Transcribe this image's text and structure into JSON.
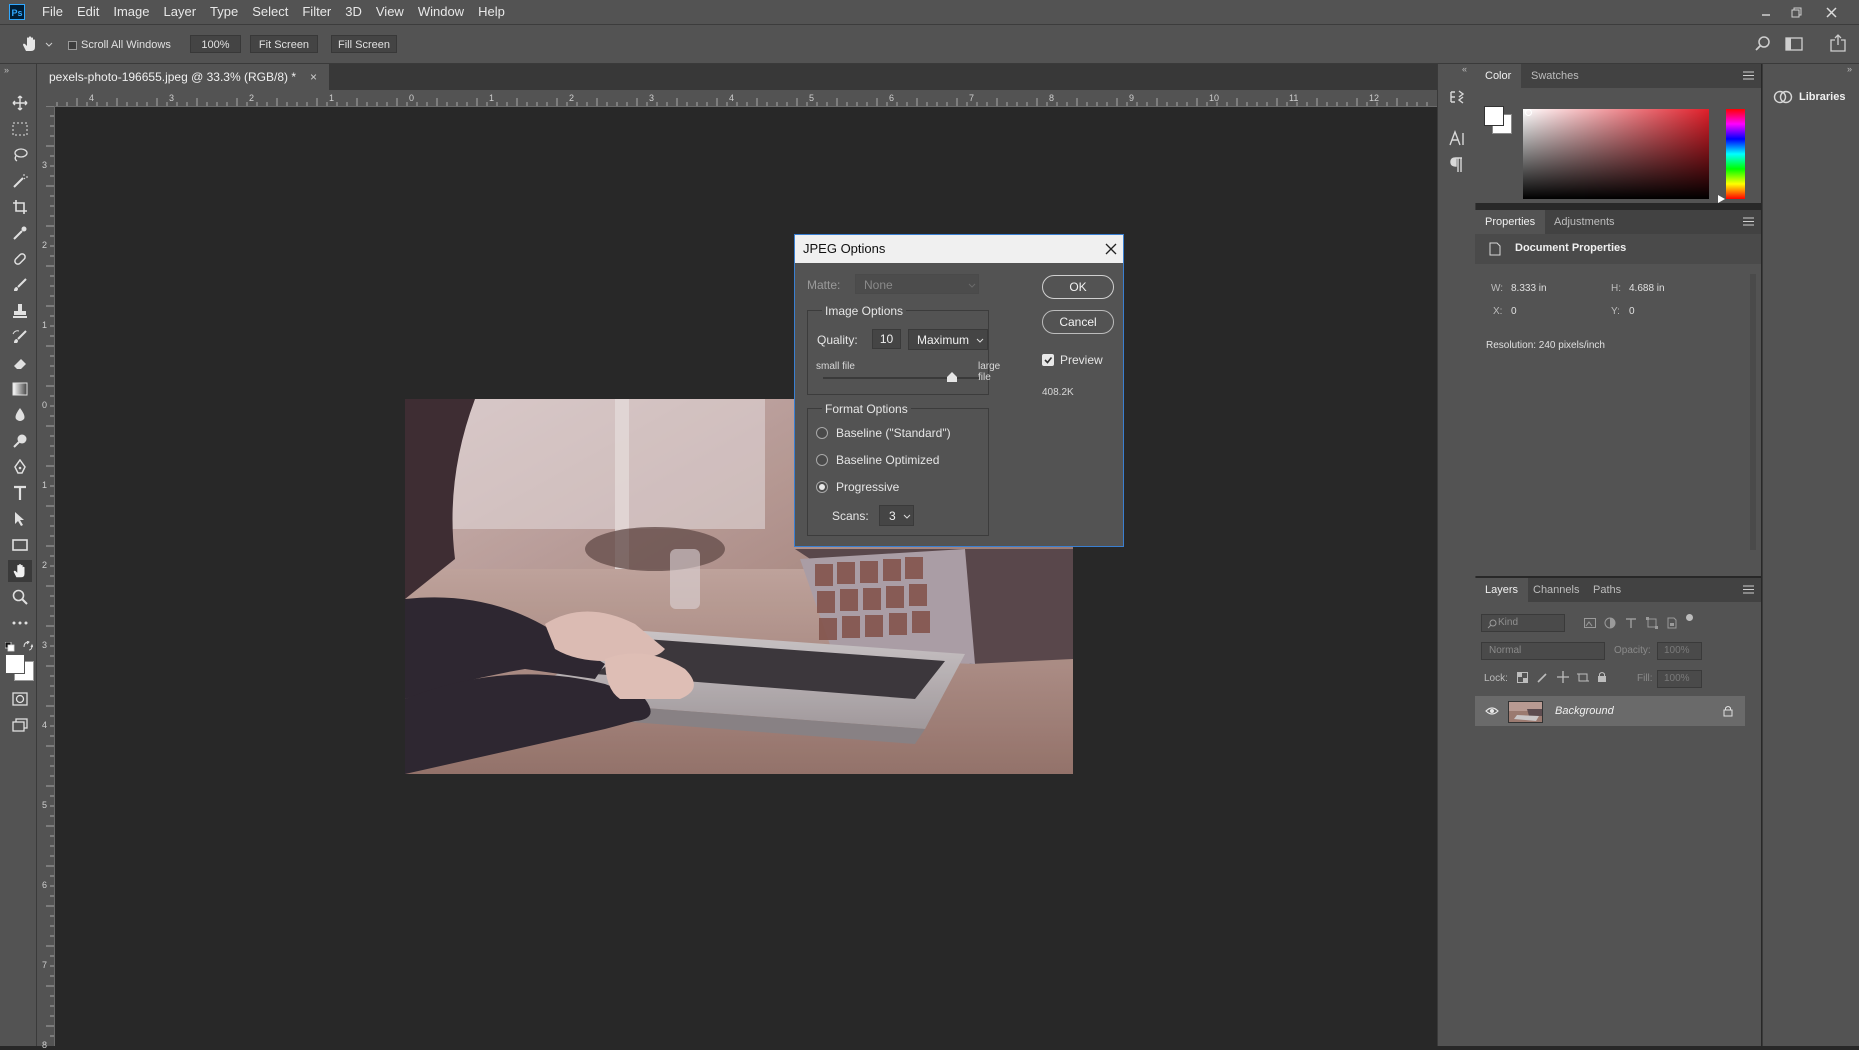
{
  "menubar": {
    "items": [
      "File",
      "Edit",
      "Image",
      "Layer",
      "Type",
      "Select",
      "Filter",
      "3D",
      "View",
      "Window",
      "Help"
    ]
  },
  "options": {
    "scroll_all_windows": "Scroll All Windows",
    "zoom": "100%",
    "fit_screen": "Fit Screen",
    "fill_screen": "Fill Screen"
  },
  "document": {
    "tab_title": "pexels-photo-196655.jpeg @ 33.3% (RGB/8) *",
    "close": "×"
  },
  "ruler": {
    "h": [
      "4",
      "3",
      "2",
      "1",
      "0",
      "1",
      "2",
      "3",
      "4",
      "5",
      "6",
      "7",
      "8",
      "9",
      "10",
      "11",
      "12"
    ],
    "v": [
      "3",
      "2",
      "1",
      "0",
      "1",
      "2",
      "3",
      "4",
      "5",
      "6",
      "7",
      "8"
    ]
  },
  "dialog": {
    "title": "JPEG Options",
    "matte_label": "Matte:",
    "matte_value": "None",
    "image_options": "Image Options",
    "quality_label": "Quality:",
    "quality_value": "10",
    "quality_preset": "Maximum",
    "small_file": "small file",
    "large_file": "large file",
    "quality_level": 0.83,
    "ok": "OK",
    "cancel": "Cancel",
    "preview": "Preview",
    "preview_checked": true,
    "file_size": "408.2K",
    "format_options": "Format Options",
    "formats": [
      "Baseline (\"Standard\")",
      "Baseline Optimized",
      "Progressive"
    ],
    "selected_format": "Progressive",
    "scans_label": "Scans:",
    "scans_value": "3"
  },
  "color_panel": {
    "tabs": [
      "Color",
      "Swatches"
    ],
    "hue_color": "#e01f2a"
  },
  "properties_panel": {
    "tabs": [
      "Properties",
      "Adjustments"
    ],
    "header": "Document Properties",
    "w_label": "W:",
    "w_value": "8.333 in",
    "h_label": "H:",
    "h_value": "4.688 in",
    "x_label": "X:",
    "x_value": "0",
    "y_label": "Y:",
    "y_value": "0",
    "resolution": "Resolution: 240 pixels/inch"
  },
  "layers_panel": {
    "tabs": [
      "Layers",
      "Channels",
      "Paths"
    ],
    "kind": "Kind",
    "blend_mode": "Normal",
    "opacity_label": "Opacity:",
    "opacity_value": "100%",
    "lock_label": "Lock:",
    "fill_label": "Fill:",
    "fill_value": "100%",
    "layer_name": "Background"
  },
  "libraries": {
    "label": "Libraries"
  }
}
